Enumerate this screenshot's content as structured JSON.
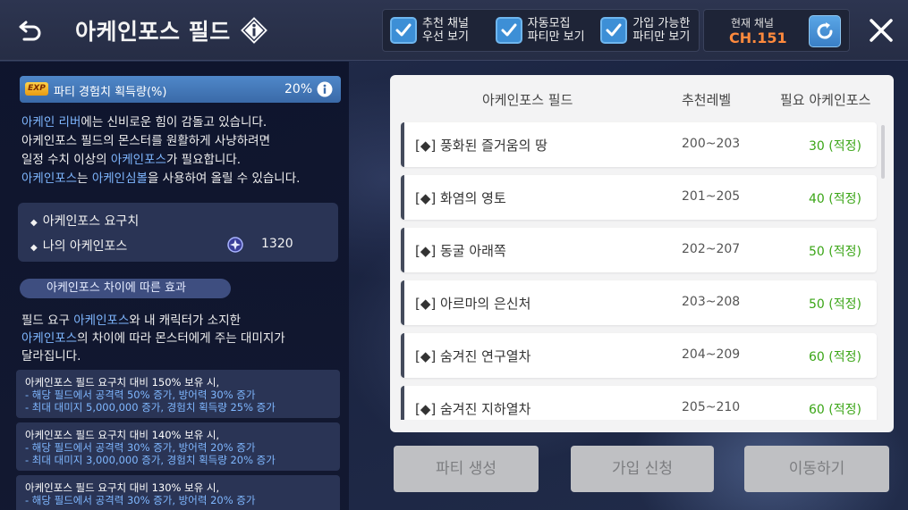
{
  "header": {
    "title": "아케인포스 필드",
    "toggles": [
      {
        "label": "추천 채널\n우선 보기",
        "checked": true
      },
      {
        "label": "자동모집\n파티만 보기",
        "checked": true
      },
      {
        "label": "가입 가능한\n파티만 보기",
        "checked": true
      }
    ],
    "channel_label": "현재 채널",
    "channel_value": "CH.151"
  },
  "left": {
    "exp_badge": "EXP",
    "exp_label": "파티 경험치 획득량(%)",
    "exp_value": "20%",
    "desc": {
      "l1_hl": "아케인 리버",
      "l1_rest": "에는 신비로운 힘이 감돌고 있습니다.",
      "l2": "아케인포스 필드의 몬스터를 원활하게 사냥하려면",
      "l3_pre": "일정 수치 이상의 ",
      "l3_hl": "아케인포스",
      "l3_post": "가 필요합니다.",
      "l4_hl1": "아케인포스",
      "l4_mid": "는 ",
      "l4_hl2": "아케인심볼",
      "l4_post": "을 사용하여 올릴 수 있습니다."
    },
    "req_label": "아케인포스 요구치",
    "my_label": "나의 아케인포스",
    "my_value": "1320",
    "section_title": "아케인포스 차이에 따른 효과",
    "effect": {
      "l1_pre": "필드 요구 ",
      "l1_hl": "아케인포스",
      "l1_post": "와 내 캐릭터가 소지한",
      "l2_hl": "아케인포스",
      "l2_post": "의 차이에 따라 몬스터에게 주는 대미지가",
      "l3": "달라집니다."
    },
    "cards": [
      {
        "title": "아케인포스 필드 요구치 대비 150% 보유 시,",
        "line1": "- 해당 필드에서 공격력 50% 증가, 방어력 30% 증가",
        "line2": "- 최대 대미지 5,000,000 증가, 경험치 획득량 25% 증가"
      },
      {
        "title": "아케인포스 필드 요구치 대비 140% 보유 시,",
        "line1": "- 해당 필드에서 공격력 30% 증가, 방어력 20% 증가",
        "line2": "- 최대 대미지 3,000,000 증가, 경험치 획득량 20% 증가"
      },
      {
        "title": "아케인포스 필드 요구치 대비 130% 보유 시,",
        "line1": "- 해당 필드에서 공격력 30% 증가, 방어력 20% 증가",
        "line2": ""
      }
    ]
  },
  "table": {
    "headers": [
      "아케인포스 필드",
      "추천레벨",
      "필요 아케인포스"
    ],
    "rows": [
      {
        "name": "[◆] 풍화된 즐거움의 땅",
        "level": "200~203",
        "req": "30 (적정)"
      },
      {
        "name": "[◆] 화염의 영토",
        "level": "201~205",
        "req": "40 (적정)"
      },
      {
        "name": "[◆] 동굴 아래쪽",
        "level": "202~207",
        "req": "50 (적정)"
      },
      {
        "name": "[◆] 아르마의 은신처",
        "level": "203~208",
        "req": "50 (적정)"
      },
      {
        "name": "[◆] 숨겨진 연구열차",
        "level": "204~209",
        "req": "60 (적정)"
      },
      {
        "name": "[◆] 숨겨진 지하열차",
        "level": "205~210",
        "req": "60 (적정)"
      }
    ]
  },
  "buttons": {
    "create_party": "파티 생성",
    "join_request": "가입 신청",
    "move": "이동하기"
  }
}
